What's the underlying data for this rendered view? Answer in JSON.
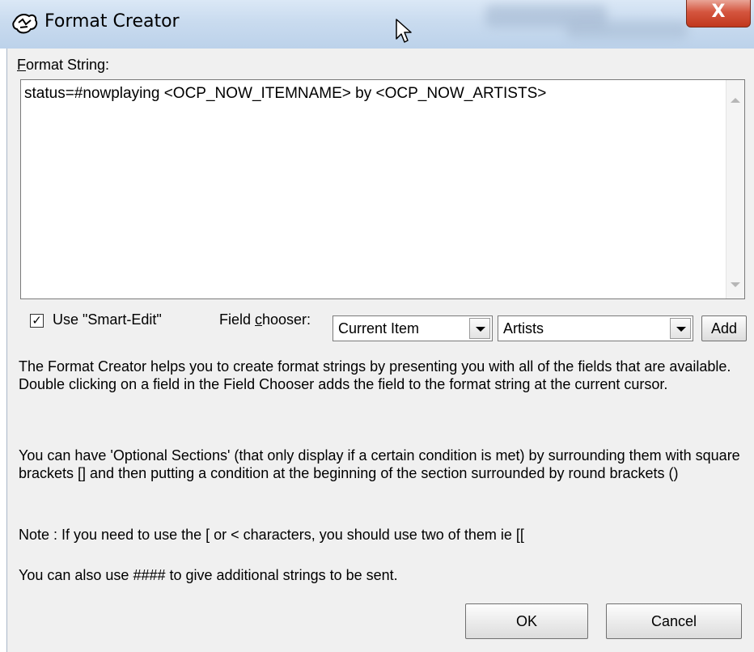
{
  "window": {
    "title": "Format Creator",
    "close_label": "X"
  },
  "format_string": {
    "label_accel": "F",
    "label_rest": "ormat String:",
    "value": "status=#nowplaying <OCP_NOW_ITEMNAME> by <OCP_NOW_ARTISTS>"
  },
  "smart_edit": {
    "label": "Use \"Smart-Edit\"",
    "checked_mark": "✓"
  },
  "field_chooser": {
    "label_pre": "Field ",
    "label_accel": "c",
    "label_post": "hooser:",
    "scope": "Current Item",
    "field": "Artists",
    "add_label": "Add"
  },
  "help": {
    "p1": "The Format Creator helps you to create format strings by presenting you with all of the fields that are available. Double clicking on a field in the Field Chooser adds the field to the format string at the current cursor.",
    "p2": "You can have 'Optional Sections' (that only display if a certain condition is met) by surrounding them with square brackets [] and then putting a condition at the beginning of the section surrounded by round brackets ()",
    "p3": "Note : If you need to use the [ or < characters, you should use two of them ie [[",
    "p4": "You can also use #### to give additional strings to be sent."
  },
  "buttons": {
    "ok": "OK",
    "cancel": "Cancel"
  }
}
